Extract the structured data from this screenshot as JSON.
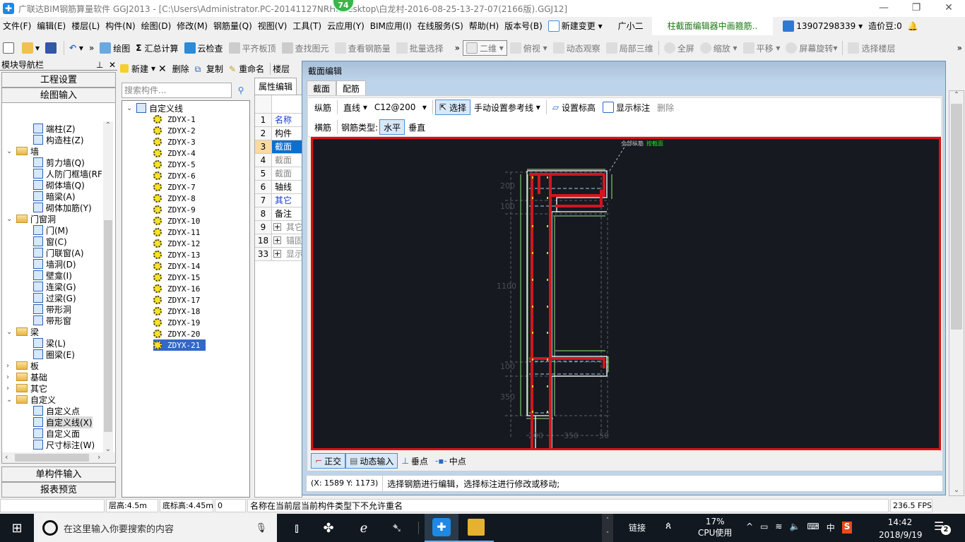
{
  "window": {
    "title": "广联达BIM钢筋算量软件 GGJ2013 - [C:\\Users\\Administrator.PC-20141127NRHI\\Desktop\\白龙村-2016-08-25-13-27-07(2166版).GGJ12]",
    "badge": "74",
    "controls": {
      "minimize": "—",
      "restore": "❐",
      "close": "✕"
    }
  },
  "menubar": {
    "items": [
      "文件(F)",
      "编辑(E)",
      "楼层(L)",
      "构件(N)",
      "绘图(D)",
      "修改(M)",
      "钢筋量(Q)",
      "视图(V)",
      "工具(T)",
      "云应用(Y)",
      "BIM应用(I)",
      "在线服务(S)",
      "帮助(H)",
      "版本号(B)"
    ],
    "new_change": "新建变更",
    "assistant": "广小二",
    "tip_link": "柱截面编辑器中画箍筋..",
    "account": "13907298339",
    "beans": "造价豆:0"
  },
  "toolbar": {
    "draw": "绘图",
    "summary": "汇总计算",
    "cloud_check": "云检查",
    "align_slab": "平齐板顶",
    "find_element": "查找图元",
    "view_rebar": "查看钢筋量",
    "batch_select": "批量选择",
    "view_mode": "二维",
    "perspective": "俯视",
    "dynamic_view": "动态观察",
    "local_3d": "局部三维",
    "fullscreen": "全屏",
    "zoom": "缩放",
    "pan": "平移",
    "rotate": "屏幕旋转",
    "select_floor": "选择楼层"
  },
  "nav": {
    "title": "模块导航栏",
    "project_settings": "工程设置",
    "drawing_input": "绘图输入",
    "single_input": "单构件输入",
    "report_preview": "报表预览",
    "tree": [
      {
        "label": "端柱(Z)",
        "level": 2
      },
      {
        "label": "构造柱(Z)",
        "level": 2
      },
      {
        "label": "墙",
        "level": 1,
        "folder": true,
        "expanded": true
      },
      {
        "label": "剪力墙(Q)",
        "level": 2
      },
      {
        "label": "人防门框墙(RF",
        "level": 2
      },
      {
        "label": "砌体墙(Q)",
        "level": 2
      },
      {
        "label": "暗梁(A)",
        "level": 2
      },
      {
        "label": "砌体加筋(Y)",
        "level": 2
      },
      {
        "label": "门窗洞",
        "level": 1,
        "folder": true,
        "expanded": true
      },
      {
        "label": "门(M)",
        "level": 2
      },
      {
        "label": "窗(C)",
        "level": 2
      },
      {
        "label": "门联窗(A)",
        "level": 2
      },
      {
        "label": "墙洞(D)",
        "level": 2
      },
      {
        "label": "壁龛(I)",
        "level": 2
      },
      {
        "label": "连梁(G)",
        "level": 2
      },
      {
        "label": "过梁(G)",
        "level": 2
      },
      {
        "label": "带形洞",
        "level": 2
      },
      {
        "label": "带形窗",
        "level": 2
      },
      {
        "label": "梁",
        "level": 1,
        "folder": true,
        "expanded": true
      },
      {
        "label": "梁(L)",
        "level": 2
      },
      {
        "label": "圈梁(E)",
        "level": 2
      },
      {
        "label": "板",
        "level": 1,
        "folder": true,
        "expanded": false
      },
      {
        "label": "基础",
        "level": 1,
        "folder": true,
        "expanded": false
      },
      {
        "label": "其它",
        "level": 1,
        "folder": true,
        "expanded": false
      },
      {
        "label": "自定义",
        "level": 1,
        "folder": true,
        "expanded": true
      },
      {
        "label": "自定义点",
        "level": 2
      },
      {
        "label": "自定义线(X)",
        "level": 2,
        "selected": true
      },
      {
        "label": "自定义面",
        "level": 2
      },
      {
        "label": "尺寸标注(W)",
        "level": 2
      }
    ]
  },
  "component_list": {
    "new": "新建",
    "delete": "删除",
    "copy": "复制",
    "rename": "重命名",
    "floor": "楼层",
    "search_placeholder": "搜索构件...",
    "root": "自定义线",
    "items": [
      "ZDYX-1",
      "ZDYX-2",
      "ZDYX-3",
      "ZDYX-4",
      "ZDYX-5",
      "ZDYX-6",
      "ZDYX-7",
      "ZDYX-8",
      "ZDYX-9",
      "ZDYX-10",
      "ZDYX-11",
      "ZDYX-12",
      "ZDYX-13",
      "ZDYX-14",
      "ZDYX-15",
      "ZDYX-16",
      "ZDYX-17",
      "ZDYX-18",
      "ZDYX-19",
      "ZDYX-20",
      "ZDYX-21"
    ],
    "selected": "ZDYX-21"
  },
  "properties": {
    "tab": "属性编辑",
    "rows": [
      {
        "n": "1",
        "v": "名称",
        "style": "blue"
      },
      {
        "n": "2",
        "v": "构件",
        "style": "normal"
      },
      {
        "n": "3",
        "v": "截面",
        "style": "selected"
      },
      {
        "n": "4",
        "v": "截面",
        "style": "gray"
      },
      {
        "n": "5",
        "v": "截面",
        "style": "gray"
      },
      {
        "n": "6",
        "v": "轴线",
        "style": "normal"
      },
      {
        "n": "7",
        "v": "其它",
        "style": "blue"
      },
      {
        "n": "8",
        "v": "备注",
        "style": "normal"
      },
      {
        "n": "9",
        "v": "其它",
        "style": "group"
      },
      {
        "n": "18",
        "v": "锚固",
        "style": "group"
      },
      {
        "n": "33",
        "v": "显示",
        "style": "group"
      }
    ]
  },
  "dialog": {
    "title": "截面编辑",
    "tabs": [
      "截面",
      "配筋"
    ],
    "active_tab": "配筋",
    "row1": {
      "longitudinal": "纵筋",
      "line_type": "直线",
      "rebar_spec": "C12@200",
      "select": "选择",
      "ref_line": "手动设置参考线",
      "set_elevation": "设置标高",
      "show_label": "显示标注",
      "delete": "删除"
    },
    "row2": {
      "transverse": "横筋",
      "rebar_type_label": "钢筋类型:",
      "horizontal": "水平",
      "vertical": "垂直"
    },
    "canvas": {
      "dims_vertical": [
        "200",
        "100",
        "1100",
        "100",
        "350"
      ],
      "dims_horizontal": [
        "200",
        "350",
        "50"
      ],
      "note_label": "全部纵筋",
      "note_value": "按截面"
    },
    "bottom": {
      "ortho": "正交",
      "dynamic_input": "动态输入",
      "perp_point": "垂点",
      "mid_point": "中点"
    },
    "status_coords": "(X: 1589 Y: 1173)",
    "status_msg": "选择钢筋进行编辑，选择标注进行修改或移动;"
  },
  "statusbar": {
    "floor_height": "层高:4.5m",
    "base_elev": "底标高:4.45m",
    "value": "0",
    "message": "名称在当前层当前构件类型下不允许重名",
    "fps": "236.5 FPS"
  },
  "taskbar": {
    "search_placeholder": "在这里输入你要搜索的内容",
    "link": "链接",
    "cpu_pct": "17%",
    "cpu_label": "CPU使用",
    "ime": "中",
    "time": "14:42",
    "date": "2018/9/19",
    "notifications": "2"
  },
  "colors": {
    "canvas_bg": "#161920",
    "canvas_border": "#e01010",
    "rebar": "#d0161e",
    "dim_line": "#7cc36a",
    "selection": "#3367c8"
  }
}
